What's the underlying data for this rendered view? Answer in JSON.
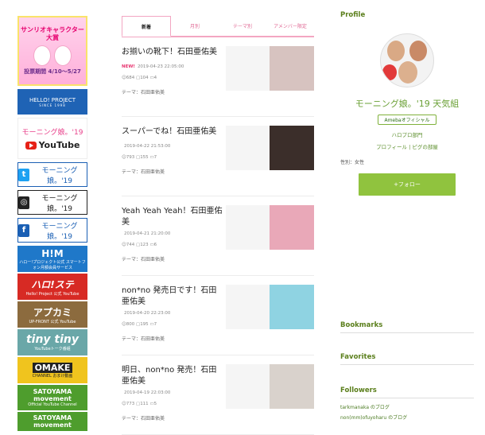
{
  "left_banners": {
    "sanrio": {
      "title": "サンリオキャラクター大賞",
      "subtitle": "投票期間 4/10～5/27"
    },
    "hp": {
      "title": "HELLO! PROJECT",
      "sub": "SINCE 1998"
    },
    "yt": {
      "top": "モーニング娘。'19",
      "bottom": "YouTube"
    },
    "twitter": "モーニング娘。'19",
    "instagram": "モーニング娘。'19",
    "facebook": "モーニング娘。'19",
    "hm": {
      "big": "H!M",
      "small": "ハロー!プロジェクト公式 スマートフォン月額会員サービス"
    },
    "hellostation": {
      "big": "ハロ!ステ",
      "small": "Hello! Project 公式 YouTube"
    },
    "upfront": {
      "big": "アプカミ",
      "small": "UP-FRONT 公式 YouTube"
    },
    "tiny": {
      "big": "tiny tiny",
      "small": "YouTubeトーク番組"
    },
    "omake": {
      "big": "OMAKE",
      "small": "CHANNEL おまけ動画"
    },
    "satoyama": {
      "big": "SATOYAMA movement",
      "small": "Official YouTube Channel"
    },
    "satoyama2": "SATOYAMA movement"
  },
  "tabs": [
    {
      "label": "新着"
    },
    {
      "label": "月別"
    },
    {
      "label": "テーマ別"
    },
    {
      "label": "アメンバー限定"
    }
  ],
  "entries": [
    {
      "title": "お揃いの靴下！石田亜佑美",
      "new": "NEW!",
      "date": "2019-04-23 22:05:00",
      "likes": "684",
      "comments": "104",
      "reblogs": "4",
      "theme": "テーマ：石田亜佑美",
      "photo_color": "#d7c3c0"
    },
    {
      "title": "スーパーでね！石田亜佑美",
      "new": "",
      "date": "2019-04-22 21:53:00",
      "likes": "793",
      "comments": "155",
      "reblogs": "7",
      "theme": "テーマ：石田亜佑美",
      "photo_color": "#3b2e2a"
    },
    {
      "title": "Yeah Yeah Yeah！石田亜佑美",
      "new": "",
      "date": "2019-04-21 21:20:00",
      "likes": "744",
      "comments": "123",
      "reblogs": "6",
      "theme": "テーマ：石田亜佑美",
      "photo_color": "#e9a8b8"
    },
    {
      "title": "non*no 発売日です！石田亜佑美",
      "new": "",
      "date": "2019-04-20 22:23:00",
      "likes": "800",
      "comments": "195",
      "reblogs": "7",
      "theme": "テーマ：石田亜佑美",
      "photo_color": "#8fd3e2"
    },
    {
      "title": "明日、non*no 発売！石田亜佑美",
      "new": "",
      "date": "2019-04-19 22:03:00",
      "likes": "773",
      "comments": "111",
      "reblogs": "5",
      "theme": "テーマ：石田亜佑美",
      "photo_color": "#d9d2cc"
    }
  ],
  "profile": {
    "heading": "Profile",
    "name": "モーニング娘。'19 天気組",
    "official": "Amebaオフィシャル",
    "link1": "ハロプロ部門",
    "link2": "プロフィール | ピグの部屋",
    "gender": "性別：女性",
    "follow": "+フォロー"
  },
  "bookmarks": {
    "heading": "Bookmarks"
  },
  "favorites": {
    "heading": "Favorites"
  },
  "followers": {
    "heading": "Followers",
    "items": [
      "tarkmanaka のブログ",
      "non(mm)ofuyoharu のブログ"
    ]
  },
  "colors": {
    "accent_green": "#90c33e",
    "tab_pink": "#f3a6c2",
    "new_red": "#e8336f"
  }
}
